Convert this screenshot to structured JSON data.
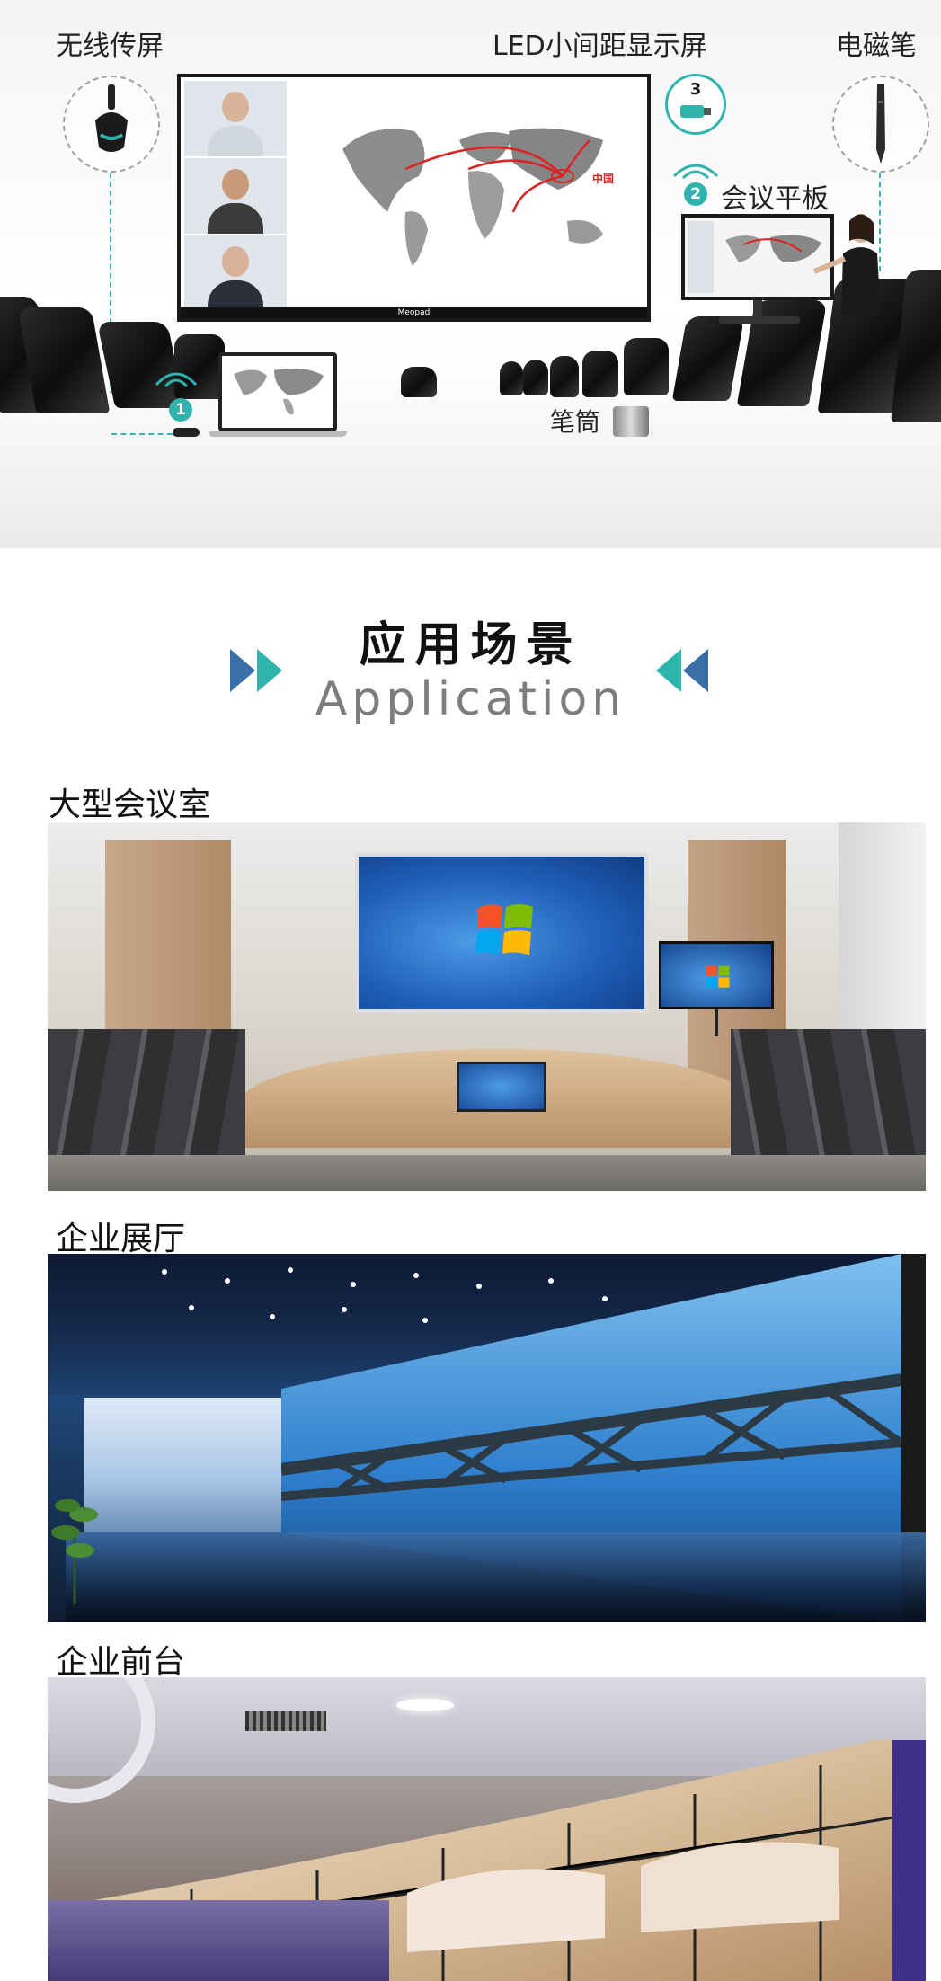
{
  "hero": {
    "label_wireless": "无线传屏",
    "label_led": "LED小间距显示屏",
    "label_pen": "电磁笔",
    "label_tablet": "会议平板",
    "label_penholder": "笔筒",
    "step1": "1",
    "step2": "2",
    "step3": "3",
    "map_china": "中国",
    "screen_brand": "Meopad"
  },
  "section": {
    "title_zh": "应用场景",
    "title_en": "Application"
  },
  "scenes": [
    {
      "title": "大型会议室"
    },
    {
      "title": "企业展厅"
    },
    {
      "title": "企业前台"
    }
  ],
  "colors": {
    "teal": "#2fb3ad",
    "blue": "#3a6ea8",
    "dark": "#111111"
  }
}
